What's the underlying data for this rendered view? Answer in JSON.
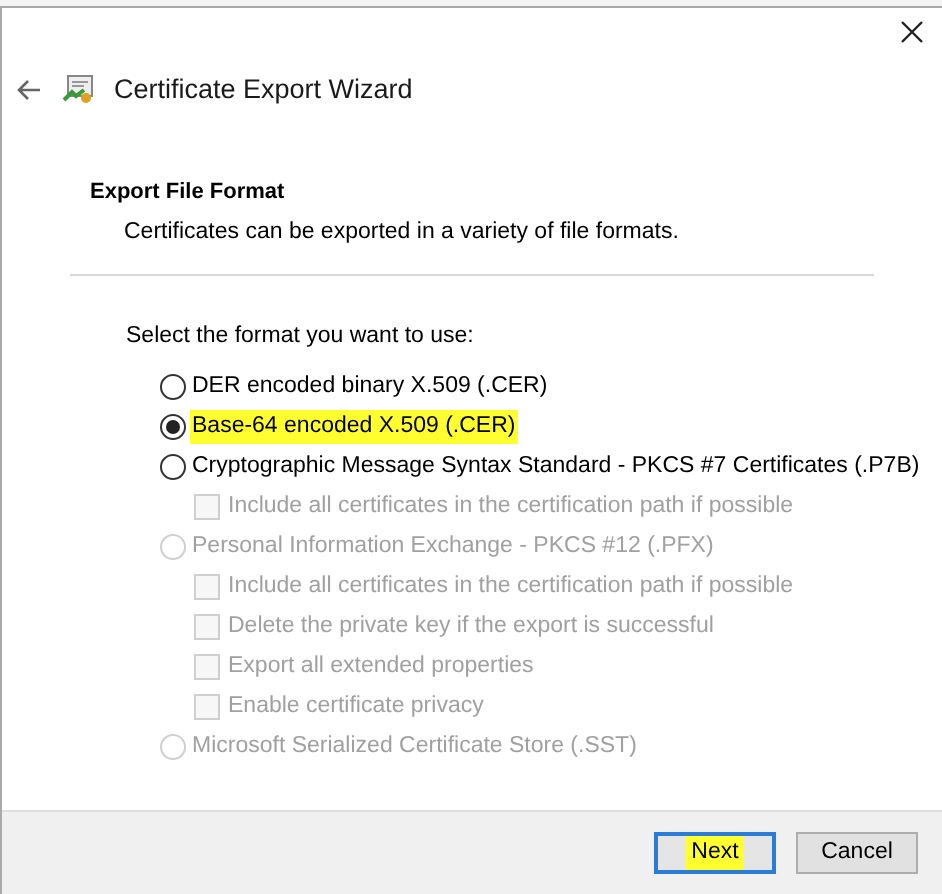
{
  "window": {
    "title": "Certificate Export Wizard"
  },
  "header": {
    "title": "Export File Format",
    "subtitle": "Certificates can be exported in a variety of file formats."
  },
  "prompt": "Select the format you want to use:",
  "formats": [
    {
      "label": "DER encoded binary X.509 (.CER)",
      "selected": false,
      "disabled": false,
      "highlighted": false
    },
    {
      "label": "Base-64 encoded X.509 (.CER)",
      "selected": true,
      "disabled": false,
      "highlighted": true
    },
    {
      "label": "Cryptographic Message Syntax Standard - PKCS #7 Certificates (.P7B)",
      "selected": false,
      "disabled": false,
      "highlighted": false,
      "options": [
        {
          "label": "Include all certificates in the certification path if possible",
          "checked": false,
          "disabled": true
        }
      ]
    },
    {
      "label": "Personal Information Exchange - PKCS #12 (.PFX)",
      "selected": false,
      "disabled": true,
      "highlighted": false,
      "options": [
        {
          "label": "Include all certificates in the certification path if possible",
          "checked": false,
          "disabled": true
        },
        {
          "label": "Delete the private key if the export is successful",
          "checked": false,
          "disabled": true
        },
        {
          "label": "Export all extended properties",
          "checked": false,
          "disabled": true
        },
        {
          "label": "Enable certificate privacy",
          "checked": false,
          "disabled": true
        }
      ]
    },
    {
      "label": "Microsoft Serialized Certificate Store (.SST)",
      "selected": false,
      "disabled": true,
      "highlighted": false
    }
  ],
  "buttons": [
    {
      "label": "Next",
      "kind": "default",
      "highlighted": true
    },
    {
      "label": "Cancel",
      "kind": "normal",
      "highlighted": false
    }
  ]
}
